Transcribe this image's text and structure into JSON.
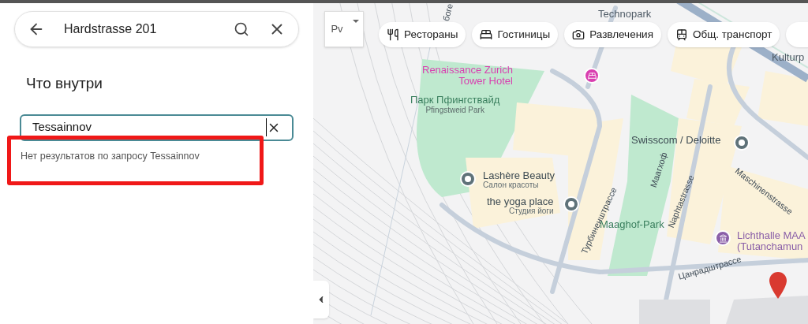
{
  "search": {
    "value": "Hardstrasse 201"
  },
  "panel": {
    "title": "Что внутри",
    "field": {
      "value": "Tessainnov"
    },
    "message": "Нет результатов по запросу Tessainnov"
  },
  "map": {
    "layer_button": "Pv",
    "chips": [
      {
        "kind": "restaurant",
        "label": "Рестораны"
      },
      {
        "kind": "hotel",
        "label": "Гостиницы"
      },
      {
        "kind": "camera",
        "label": "Развлечения"
      },
      {
        "kind": "transit",
        "label": "Общ. транспорт"
      }
    ],
    "places": [
      {
        "kind": "hotel",
        "name": "Renaissance Zurich",
        "name2": "Tower Hotel",
        "color": "#d93fb0"
      },
      {
        "kind": "poi",
        "name": "Lashère Beauty",
        "sub": "Салон красоты",
        "color": "#5f7279"
      },
      {
        "kind": "poi",
        "name": "the yoga place",
        "sub": "Студия йоги",
        "color": "#5f7279"
      },
      {
        "kind": "poi",
        "name": "Swisscom / Deloitte",
        "color": "#5f7279"
      },
      {
        "kind": "museum",
        "name": "Lichthalle MAA",
        "name2": "(Tutanchamun",
        "color": "#8a5fa8"
      }
    ],
    "labels": [
      {
        "kind": "park",
        "text": "Парк Пфингствайд",
        "sub": "Pfingstweid Park"
      },
      {
        "kind": "park",
        "text": "Maaghof-Park"
      },
      {
        "kind": "area",
        "text": "Technopark"
      },
      {
        "kind": "area",
        "text": "Kulturp"
      }
    ],
    "streets": [
      "боге",
      "Турбиненштрассе",
      "Маагхоф",
      "Naphtastrasse",
      "Maschinenstrasse",
      "Цанрадштрассе"
    ]
  }
}
